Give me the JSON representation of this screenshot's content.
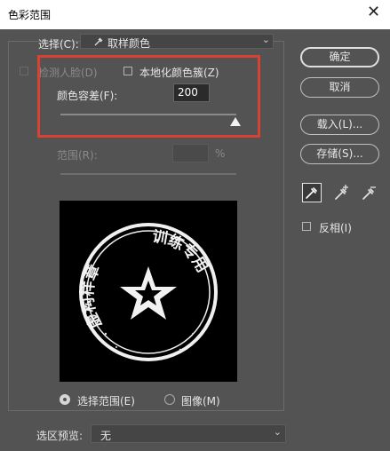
{
  "window": {
    "title": "色彩范围",
    "close_glyph": "✕"
  },
  "select": {
    "label": "选择(C):",
    "value": "取样颜色"
  },
  "detect_faces": {
    "label": "检测人脸(D)",
    "checked": false,
    "enabled": false
  },
  "localized_clusters": {
    "label": "本地化颜色簇(Z)",
    "checked": false
  },
  "fuzziness": {
    "label": "颜色容差(F):",
    "value": "200"
  },
  "range": {
    "label": "范围(R):",
    "value": "",
    "unit": "%"
  },
  "preview": {
    "stamp_top_text": "虚构样章",
    "stamp_right_text": "训练专用"
  },
  "view_mode": {
    "selection_label": "选择范围(E)",
    "image_label": "图像(M)",
    "selected": "selection"
  },
  "selection_preview": {
    "label": "选区预览:",
    "value": "无"
  },
  "buttons": {
    "ok": "确定",
    "cancel": "取消",
    "load": "载入(L)...",
    "save": "存储(S)..."
  },
  "tools": {
    "eyedropper": "eyedropper-icon",
    "add_eyedropper": "eyedropper-plus-icon",
    "subtract_eyedropper": "eyedropper-minus-icon"
  },
  "invert": {
    "label": "反相(I)",
    "checked": false
  },
  "colors": {
    "background": "#535353",
    "highlight": "#d94132"
  }
}
